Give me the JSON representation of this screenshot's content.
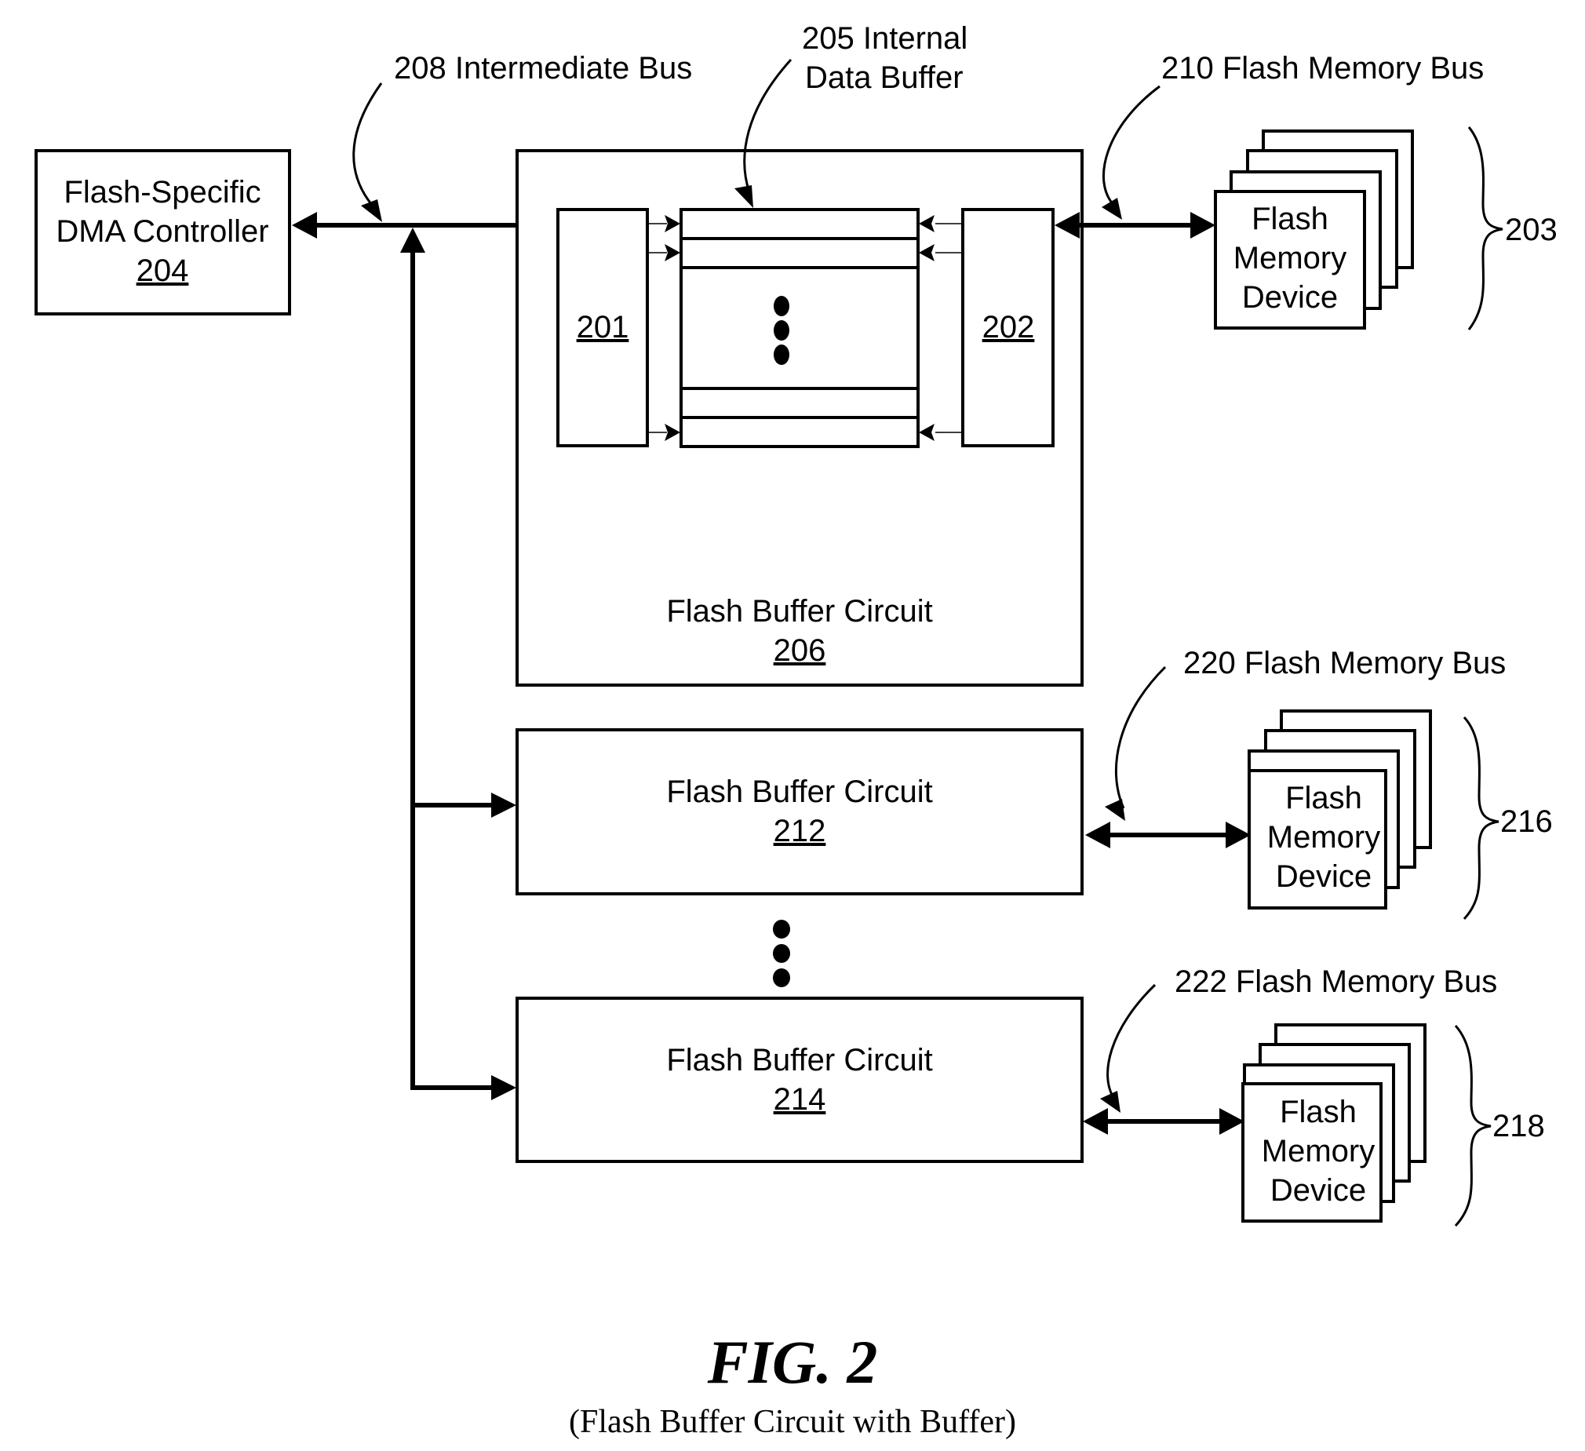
{
  "figure": {
    "title": "FIG. 2",
    "subtitle": "(Flash Buffer Circuit with Buffer)"
  },
  "dma_controller": {
    "line1": "Flash-Specific",
    "line2": "DMA Controller",
    "ref": "204"
  },
  "callouts": {
    "intermediate_bus": "208 Intermediate Bus",
    "internal_buffer_line1": "205 Internal",
    "internal_buffer_line2": "Data Buffer",
    "bus_210": "210 Flash Memory Bus",
    "bus_220": "220 Flash Memory Bus",
    "bus_222": "222 Flash Memory Bus"
  },
  "buffer_circuits": [
    {
      "label": "Flash Buffer Circuit",
      "ref": "206"
    },
    {
      "label": "Flash Buffer Circuit",
      "ref": "212"
    },
    {
      "label": "Flash Buffer Circuit",
      "ref": "214"
    }
  ],
  "inner_blocks": {
    "left_ref": "201",
    "right_ref": "202"
  },
  "flash_devices": {
    "line1": "Flash",
    "line2": "Memory",
    "line3": "Device"
  },
  "device_groups": [
    "203",
    "216",
    "218"
  ]
}
